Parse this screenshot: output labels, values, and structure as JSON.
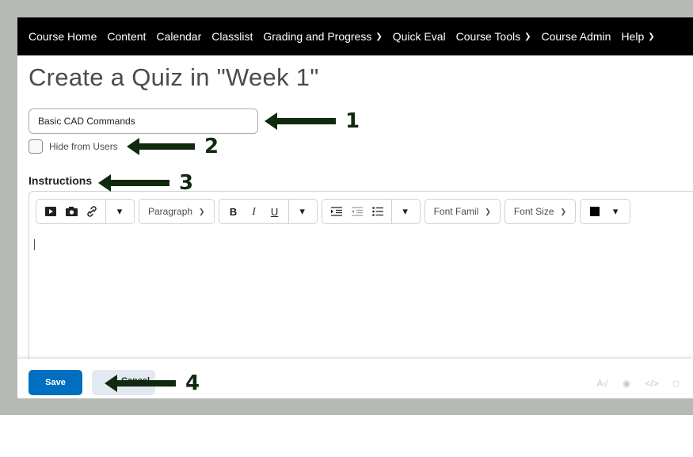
{
  "nav": {
    "items": [
      {
        "label": "Course Home",
        "chevron": false
      },
      {
        "label": "Content",
        "chevron": false
      },
      {
        "label": "Calendar",
        "chevron": false
      },
      {
        "label": "Classlist",
        "chevron": false
      },
      {
        "label": "Grading and Progress",
        "chevron": true
      },
      {
        "label": "Quick Eval",
        "chevron": false
      },
      {
        "label": "Course Tools",
        "chevron": true
      },
      {
        "label": "Course Admin",
        "chevron": false
      },
      {
        "label": "Help",
        "chevron": true
      }
    ]
  },
  "page": {
    "title": "Create a Quiz in \"Week 1\""
  },
  "form": {
    "name_value": "Basic CAD Commands",
    "hide_label": "Hide from Users",
    "hide_checked": false,
    "instructions_label": "Instructions"
  },
  "toolbar": {
    "block_format": "Paragraph",
    "font_family": "Font Famil",
    "font_size": "Font Size",
    "text_color": "#000000",
    "bold": "B",
    "italic": "I",
    "underline": "U"
  },
  "footer": {
    "save_label": "Save",
    "cancel_label": "Cancel"
  },
  "annotations": {
    "numbers": [
      "1",
      "2",
      "3",
      "4"
    ],
    "arrow_color": "#0f2a0f"
  },
  "colors": {
    "nav_bg": "#000000",
    "primary": "#006fbf",
    "frame": "#b7b9b4"
  }
}
